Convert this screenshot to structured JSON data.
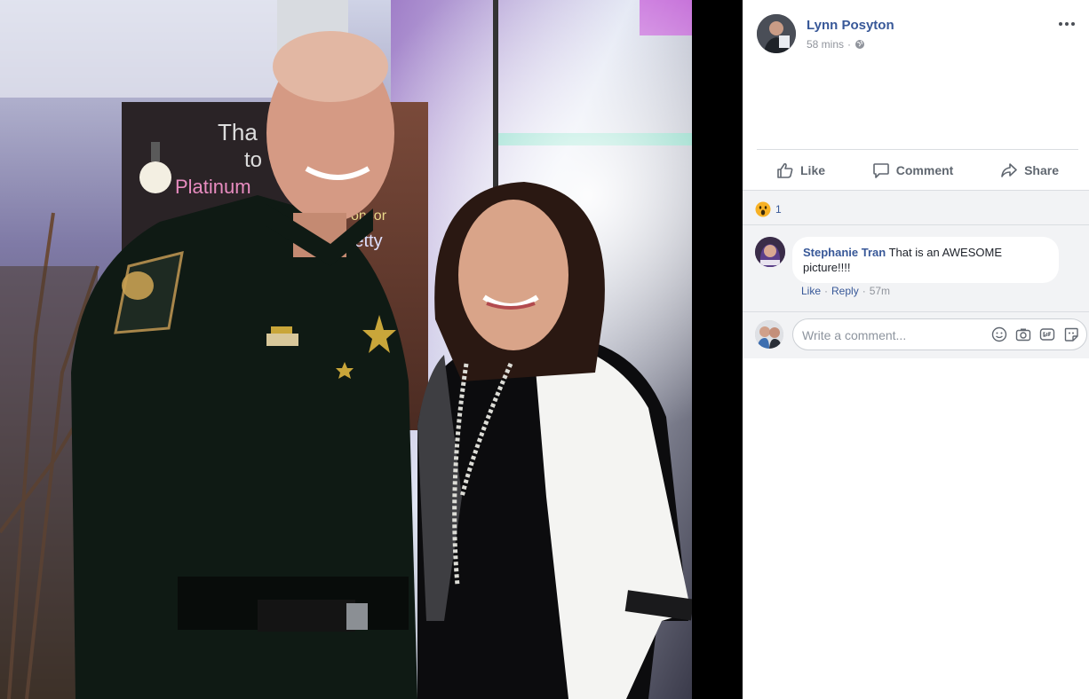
{
  "post": {
    "author": "Lynn Posyton",
    "time": "58 mins",
    "dot": "·",
    "audience_icon": "globe-icon",
    "more_icon": "more-options-icon"
  },
  "actions": [
    {
      "label": "Like",
      "icon": "thumbs-up-icon"
    },
    {
      "label": "Comment",
      "icon": "comment-icon"
    },
    {
      "label": "Share",
      "icon": "share-icon"
    }
  ],
  "reactions": {
    "icon": "wow-reaction-icon",
    "count": "1"
  },
  "comments": [
    {
      "name": "Stephanie Tran",
      "text": "That is an AWESOME picture!!!!",
      "like": "Like",
      "reply": "Reply",
      "time": "57m",
      "dot": "·"
    }
  ],
  "composer": {
    "placeholder": "Write a comment...",
    "icons": [
      "emoji-icon",
      "camera-icon",
      "gif-icon",
      "sticker-icon"
    ]
  },
  "colors": {
    "link": "#385898",
    "muted": "#90949c",
    "action": "#606770",
    "panel_bg": "#f2f3f5"
  }
}
